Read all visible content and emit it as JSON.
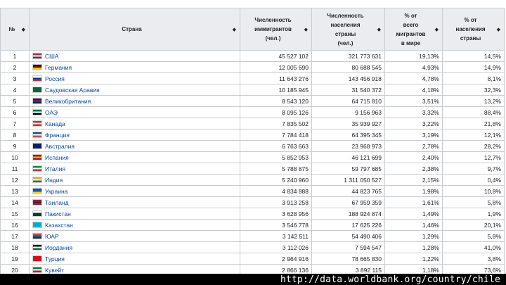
{
  "table": {
    "headers": [
      {
        "label": "№",
        "sort": "◆"
      },
      {
        "label": "Страна",
        "sort": "◆"
      },
      {
        "label": "Численность\nиммигрантов\n(чел.)",
        "sort": "◆"
      },
      {
        "label": "Численность\nнаселения\nстраны\n(чел.)",
        "sort": "◆"
      },
      {
        "label": "% от\nвсего\nмигрантов\nв мире",
        "sort": "◆"
      },
      {
        "label": "% от\nнаселения\nстраны",
        "sort": "◆"
      }
    ],
    "rows": [
      {
        "n": "1",
        "country": "США",
        "flag": [
          "#b22234",
          "#ffffff",
          "#3c3b6e"
        ],
        "immigrants": "45 527 102",
        "population": "321 773 631",
        "share_world": "19,13%",
        "share_pop": "14,5%"
      },
      {
        "n": "2",
        "country": "Германия",
        "flag": [
          "#000000",
          "#dd0000",
          "#ffce00"
        ],
        "immigrants": "12 005 690",
        "population": "80 688 545",
        "share_world": "4,93%",
        "share_pop": "14,9%"
      },
      {
        "n": "3",
        "country": "Россия",
        "flag": [
          "#ffffff",
          "#0039a6",
          "#d52b1e"
        ],
        "immigrants": "11 643 276",
        "population": "143 456 918",
        "share_world": "4,78%",
        "share_pop": "8,1%"
      },
      {
        "n": "4",
        "country": "Саудовская Аравия",
        "flag": [
          "#006c35",
          "#006c35",
          "#006c35"
        ],
        "immigrants": "10 185 945",
        "population": "31 540 372",
        "share_world": "4,18%",
        "share_pop": "32,3%"
      },
      {
        "n": "5",
        "country": "Великобритания",
        "flag": [
          "#012169",
          "#c8102e",
          "#012169"
        ],
        "immigrants": "8 543 120",
        "population": "64 715 810",
        "share_world": "3,51%",
        "share_pop": "13,2%"
      },
      {
        "n": "6",
        "country": "ОАЭ",
        "flag": [
          "#00732f",
          "#ffffff",
          "#000000"
        ],
        "immigrants": "8 095 126",
        "population": "9 156 963",
        "share_world": "3,32%",
        "share_pop": "88,4%"
      },
      {
        "n": "7",
        "country": "Канада",
        "flag": [
          "#d52b1e",
          "#ffffff",
          "#d52b1e"
        ],
        "immigrants": "7 835 502",
        "population": "35 939 927",
        "share_world": "3,22%",
        "share_pop": "21,8%"
      },
      {
        "n": "8",
        "country": "Франция",
        "flag": [
          "#0055a4",
          "#ffffff",
          "#ef4135"
        ],
        "immigrants": "7 784 418",
        "population": "64 395 345",
        "share_world": "3,19%",
        "share_pop": "12,1%"
      },
      {
        "n": "9",
        "country": "Австралия",
        "flag": [
          "#012169",
          "#012169",
          "#012169"
        ],
        "immigrants": "6 763 663",
        "population": "23 968 973",
        "share_world": "2,78%",
        "share_pop": "28,2%"
      },
      {
        "n": "10",
        "country": "Испания",
        "flag": [
          "#aa151b",
          "#f1bf00",
          "#aa151b"
        ],
        "immigrants": "5 852 953",
        "population": "46 121 699",
        "share_world": "2,40%",
        "share_pop": "12,7%"
      },
      {
        "n": "11",
        "country": "Италия",
        "flag": [
          "#009246",
          "#ffffff",
          "#ce2b37"
        ],
        "immigrants": "5 788 875",
        "population": "59 797 685",
        "share_world": "2,38%",
        "share_pop": "9,7%"
      },
      {
        "n": "12",
        "country": "Индия",
        "flag": [
          "#ff9933",
          "#ffffff",
          "#138808"
        ],
        "immigrants": "5 240 960",
        "population": "1 311 050 527",
        "share_world": "2,15%",
        "share_pop": "0,4%"
      },
      {
        "n": "13",
        "country": "Украина",
        "flag": [
          "#0057b7",
          "#0057b7",
          "#ffd700"
        ],
        "immigrants": "4 834 888",
        "population": "44 823 765",
        "share_world": "1,98%",
        "share_pop": "10,8%"
      },
      {
        "n": "14",
        "country": "Таиланд",
        "flag": [
          "#a51931",
          "#2d2a4a",
          "#a51931"
        ],
        "immigrants": "3 913 258",
        "population": "67 959 359",
        "share_world": "1,61%",
        "share_pop": "5,8%"
      },
      {
        "n": "15",
        "country": "Пакистан",
        "flag": [
          "#ffffff",
          "#01411c",
          "#01411c"
        ],
        "immigrants": "3 628 956",
        "population": "188 924 874",
        "share_world": "1,49%",
        "share_pop": "1,9%"
      },
      {
        "n": "16",
        "country": "Казахстан",
        "flag": [
          "#00afca",
          "#00afca",
          "#00afca"
        ],
        "immigrants": "3 546 778",
        "population": "17 625 226",
        "share_world": "1,46%",
        "share_pop": "20,1%"
      },
      {
        "n": "17",
        "country": "ЮАР",
        "flag": [
          "#de3831",
          "#007a4d",
          "#002395"
        ],
        "immigrants": "3 142 511",
        "population": "54 490 406",
        "share_world": "1,29%",
        "share_pop": "5,8%"
      },
      {
        "n": "18",
        "country": "Иордания",
        "flag": [
          "#000000",
          "#ffffff",
          "#007a3d"
        ],
        "immigrants": "3 112 026",
        "population": "7 594 547",
        "share_world": "1,28%",
        "share_pop": "41,0%"
      },
      {
        "n": "19",
        "country": "Турция",
        "flag": [
          "#e30a17",
          "#e30a17",
          "#e30a17"
        ],
        "immigrants": "2 964 916",
        "population": "78 665 830",
        "share_world": "1,22%",
        "share_pop": "3,8%"
      },
      {
        "n": "20",
        "country": "Кувейт",
        "flag": [
          "#007a3d",
          "#ffffff",
          "#ce1126"
        ],
        "immigrants": "2 866 136",
        "population": "3 892 115",
        "share_world": "1,18%",
        "share_pop": "73,6%"
      }
    ]
  },
  "overlay": {
    "url": "http://data.worldbank.org/country/chile"
  },
  "colors": {
    "header_bg": "#eaecf0",
    "border": "#c8ccd1",
    "link": "#0645ad",
    "overlay_bg": "#000000"
  }
}
